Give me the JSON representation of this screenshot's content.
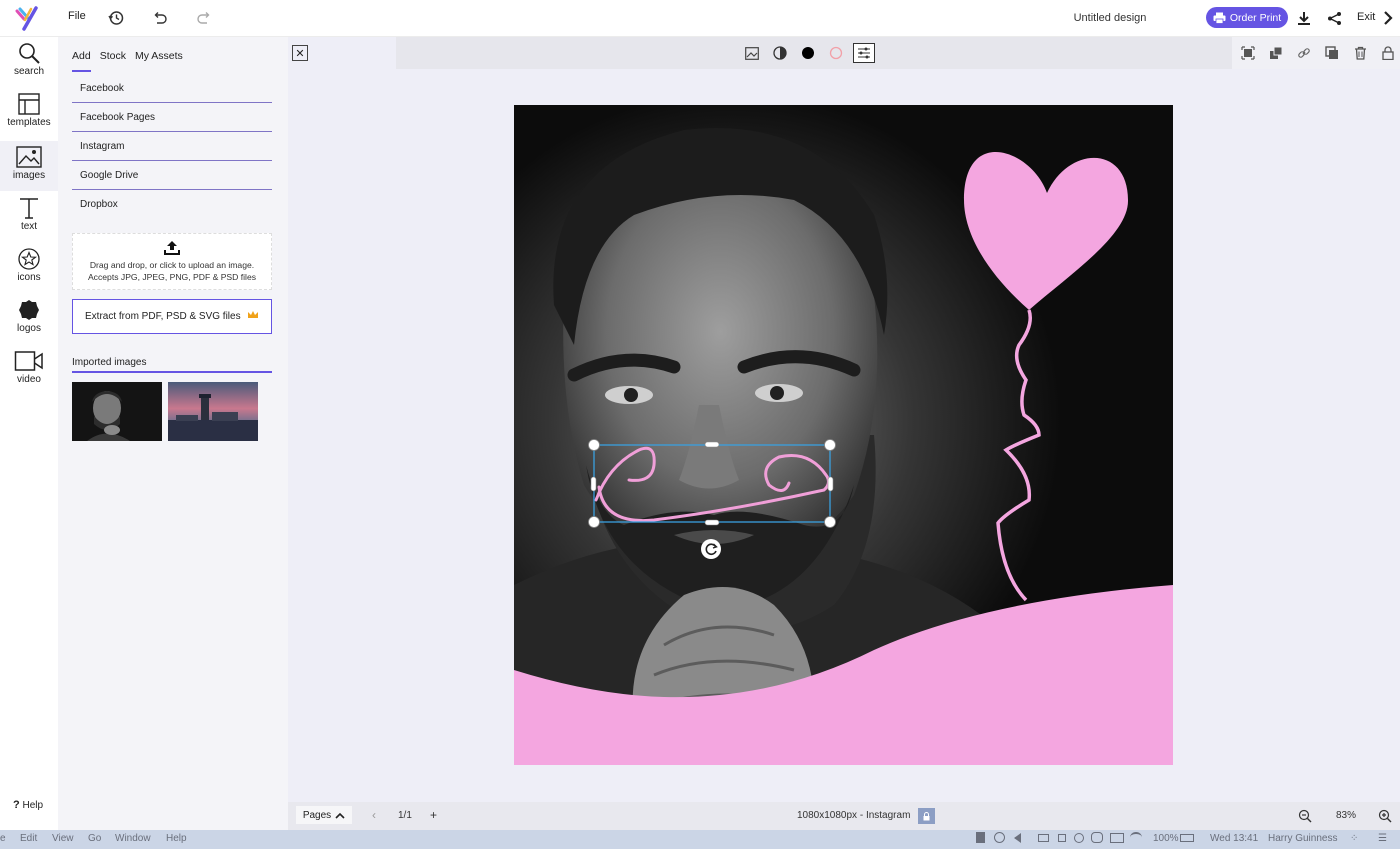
{
  "topbar": {
    "file_label": "File",
    "design_title": "Untitled design",
    "order_print_label": "Order Print",
    "exit_label": "Exit"
  },
  "rail": {
    "items": [
      {
        "label": "search"
      },
      {
        "label": "templates"
      },
      {
        "label": "images"
      },
      {
        "label": "text"
      },
      {
        "label": "icons"
      },
      {
        "label": "logos"
      },
      {
        "label": "video"
      }
    ],
    "help_label": "Help"
  },
  "panel": {
    "tabs": [
      "Add",
      "Stock",
      "My Assets"
    ],
    "sources": [
      "Facebook",
      "Facebook Pages",
      "Instagram",
      "Google Drive",
      "Dropbox"
    ],
    "upload_line1": "Drag and drop, or click to upload an image.",
    "upload_line2": "Accepts JPG, JPEG, PNG, PDF & PSD files",
    "extract_label": "Extract from PDF, PSD & SVG files",
    "imported_label": "Imported images"
  },
  "bottombar": {
    "pages_label": "Pages",
    "page_count": "1/1",
    "add_page": "+",
    "canvas_size": "1080x1080px - Instagram",
    "zoom": "83%"
  },
  "os_menu": {
    "items": [
      "e",
      "Edit",
      "View",
      "Go",
      "Window",
      "Help"
    ],
    "battery": "100%",
    "clock": "Wed 13:41",
    "user": "Harry Guinness"
  },
  "colors": {
    "accent": "#6554e3",
    "design_pink": "#f4a6e0"
  }
}
